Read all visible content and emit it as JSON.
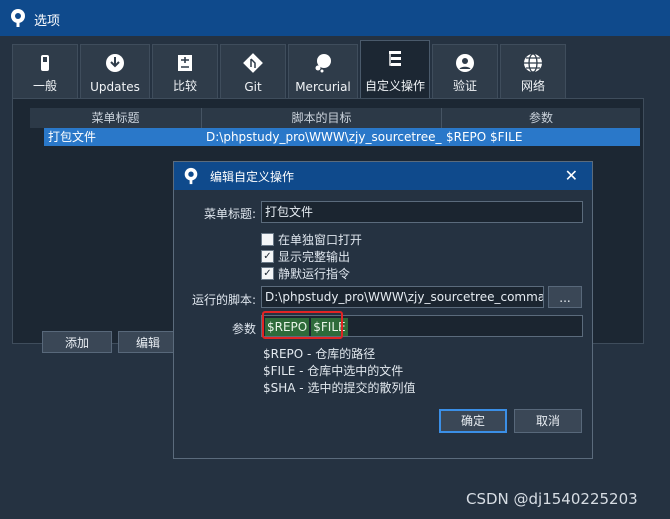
{
  "window": {
    "title": "选项"
  },
  "tabs": [
    {
      "label": "一般",
      "icon": "switch-icon"
    },
    {
      "label": "Updates",
      "icon": "download-icon"
    },
    {
      "label": "比较",
      "icon": "compare-icon"
    },
    {
      "label": "Git",
      "icon": "git-icon"
    },
    {
      "label": "Mercurial",
      "icon": "mercurial-icon"
    },
    {
      "label": "自定义操作",
      "icon": "custom-actions-icon",
      "active": true
    },
    {
      "label": "验证",
      "icon": "user-icon"
    },
    {
      "label": "网络",
      "icon": "globe-icon"
    }
  ],
  "table": {
    "headers": [
      "菜单标题",
      "脚本的目标",
      "参数"
    ],
    "rows": [
      [
        "打包文件",
        "D:\\phpstudy_pro\\WWW\\zjy_sourcetree_",
        "$REPO $FILE"
      ]
    ]
  },
  "buttons": {
    "add": "添加",
    "edit": "编辑"
  },
  "dialog": {
    "title": "编辑自定义操作",
    "close": "✕",
    "menu_title_label": "菜单标题:",
    "menu_title_value": "打包文件",
    "checkboxes": [
      {
        "label": "在单独窗口打开",
        "checked": false
      },
      {
        "label": "显示完整输出",
        "checked": true
      },
      {
        "label": "静默运行指令",
        "checked": true
      }
    ],
    "script_label": "运行的脚本:",
    "script_value": "D:\\phpstudy_pro\\WWW\\zjy_sourcetree_commar",
    "browse": "...",
    "params_label": "参数",
    "params_tokens": [
      "$REPO",
      "$FILE"
    ],
    "help": [
      "$REPO - 仓库的路径",
      "$FILE - 仓库中选中的文件",
      "$SHA - 选中的提交的散列值"
    ],
    "ok": "确定",
    "cancel": "取消"
  },
  "watermark": "CSDN @dj1540225203",
  "colors": {
    "titlebar": "#0f4a8c",
    "selection": "#2a78c9",
    "highlight": "#e02424"
  }
}
